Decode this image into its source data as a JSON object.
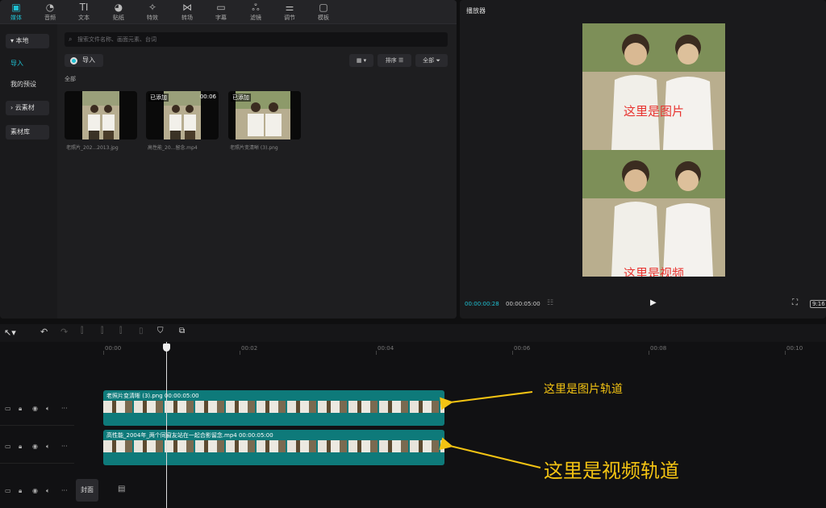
{
  "toolbar": {
    "tabs": [
      {
        "label": "媒体",
        "icon": "media-icon",
        "glyph": "▣"
      },
      {
        "label": "音频",
        "icon": "audio-icon",
        "glyph": "◔"
      },
      {
        "label": "文本",
        "icon": "text-icon",
        "glyph": "TI"
      },
      {
        "label": "贴纸",
        "icon": "sticker-icon",
        "glyph": "◕"
      },
      {
        "label": "特效",
        "icon": "effects-icon",
        "glyph": "✧"
      },
      {
        "label": "转场",
        "icon": "transition-icon",
        "glyph": "⋈"
      },
      {
        "label": "字幕",
        "icon": "subtitle-icon",
        "glyph": "▭"
      },
      {
        "label": "滤镜",
        "icon": "filter-icon",
        "glyph": "ஃ"
      },
      {
        "label": "调节",
        "icon": "adjust-icon",
        "glyph": "⚌"
      },
      {
        "label": "模板",
        "icon": "template-icon",
        "glyph": "▢"
      }
    ]
  },
  "sidebar": {
    "local": "▾ 本地",
    "import": "导入",
    "presets": "我的预设",
    "cloud": "› 云素材",
    "library": "素材库"
  },
  "media": {
    "search_placeholder": "搜索文件名称、画面元素、台词",
    "import_label": "导入",
    "sort_label": "排序",
    "filter_label": "全部",
    "section_label": "全部",
    "items": [
      {
        "name": "老照片_202...2013.jpg",
        "badge": "",
        "duration": ""
      },
      {
        "name": "高性能_20...留念.mp4",
        "badge": "已添加",
        "duration": "00:06"
      },
      {
        "name": "老照片变清晰 (3).png",
        "badge": "已添加",
        "duration": ""
      }
    ]
  },
  "player": {
    "title": "播放器",
    "overlay_top": "这里是图片",
    "overlay_bottom": "这里是视频",
    "timecode_current": "00:00:00:28",
    "timecode_total": "00:00:05:00",
    "ratio": "9:16"
  },
  "timeline": {
    "ruler": [
      "00:00",
      "00:02",
      "00:04",
      "00:06",
      "00:08",
      "00:10"
    ],
    "track1_label": "老照片变清晰 (3).png   00:00:05:00",
    "track2_label": "高性能_2004年_两个同窗友站在一起合影留念.mp4   00:00:05:00",
    "cover_label": "封面",
    "annotation_image": "这里是图片轨道",
    "annotation_video": "这里是视频轨道"
  },
  "colors": {
    "accent": "#1fc1d3",
    "track": "#0e7a7a",
    "annotation": "#f3c313",
    "overlay_text": "#e8322e"
  }
}
